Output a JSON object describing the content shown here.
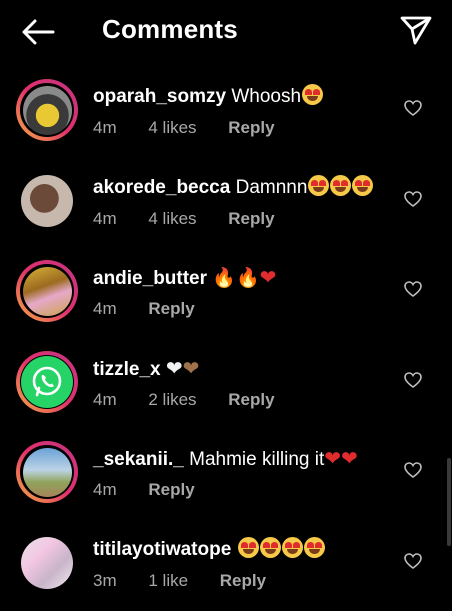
{
  "header": {
    "title": "Comments",
    "back_icon": "arrow-left-icon",
    "send_icon": "paper-plane-icon"
  },
  "colors": {
    "background": "#000000",
    "text": "#ffffff",
    "meta_text": "#a8a8a8",
    "story_ring_start": "#f5b041",
    "story_ring_end": "#c13584"
  },
  "comments": [
    {
      "username": "oparah_somzy",
      "text": "Whoosh",
      "emojis": [
        "heart-eyes"
      ],
      "time": "4m",
      "likes": "4 likes",
      "reply": "Reply",
      "has_story_ring": true
    },
    {
      "username": "akorede_becca",
      "text": "Damnnn",
      "emojis": [
        "heart-eyes",
        "heart-eyes",
        "heart-eyes"
      ],
      "time": "4m",
      "likes": "4 likes",
      "reply": "Reply",
      "has_story_ring": false
    },
    {
      "username": "andie_butter",
      "text": "",
      "emojis": [
        "fire",
        "fire",
        "red-heart"
      ],
      "time": "4m",
      "likes": "",
      "reply": "Reply",
      "has_story_ring": true
    },
    {
      "username": "tizzle_x",
      "text": "",
      "emojis": [
        "white-heart",
        "brown-heart"
      ],
      "time": "4m",
      "likes": "2 likes",
      "reply": "Reply",
      "has_story_ring": true
    },
    {
      "username": "_sekanii._",
      "text": "Mahmie killing it",
      "emojis": [
        "red-heart",
        "red-heart"
      ],
      "time": "4m",
      "likes": "",
      "reply": "Reply",
      "has_story_ring": true
    },
    {
      "username": "titilayotiwatope",
      "text": "",
      "emojis": [
        "heart-eyes",
        "heart-eyes",
        "heart-eyes",
        "heart-eyes"
      ],
      "time": "3m",
      "likes": "1 like",
      "reply": "Reply",
      "has_story_ring": false
    }
  ]
}
